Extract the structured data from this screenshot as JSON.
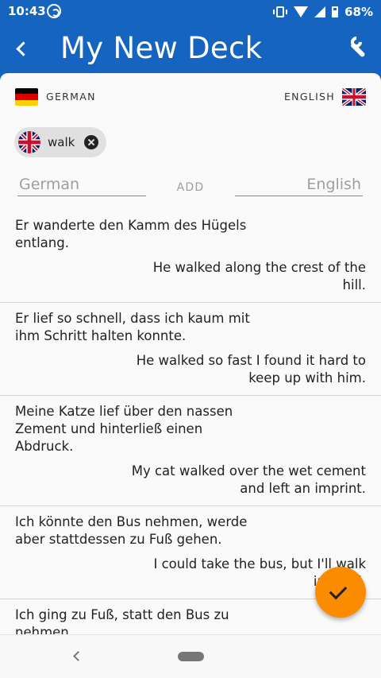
{
  "status": {
    "time": "10:43",
    "battery": "68%"
  },
  "app_bar": {
    "title": "My New Deck"
  },
  "languages": {
    "source": "GERMAN",
    "target": "ENGLISH"
  },
  "filter_chip": {
    "label": "walk"
  },
  "add_form": {
    "source_placeholder": "German",
    "target_placeholder": "English",
    "add_label": "ADD"
  },
  "cards": [
    {
      "de": "Er wanderte den Kamm des Hügels entlang.",
      "en": "He walked along the crest of the hill."
    },
    {
      "de": "Er lief so schnell, dass ich kaum mit ihm Schritt halten konnte.",
      "en": "He walked so fast I found it hard to keep up with him."
    },
    {
      "de": "Meine Katze lief über den nassen Zement und hinterließ einen Abdruck.",
      "en": "My cat walked over the wet cement and left an imprint."
    },
    {
      "de": "Ich könnte den Bus nehmen, werde aber stattdessen zu Fuß gehen.",
      "en": "I could take the bus, but I'll walk instead."
    },
    {
      "de": "Ich ging zu Fuß, statt den Bus zu nehmen.",
      "en": ""
    }
  ],
  "colors": {
    "primary": "#1565C0",
    "fab": "#FB8C00",
    "sheet": "#fafafa"
  }
}
